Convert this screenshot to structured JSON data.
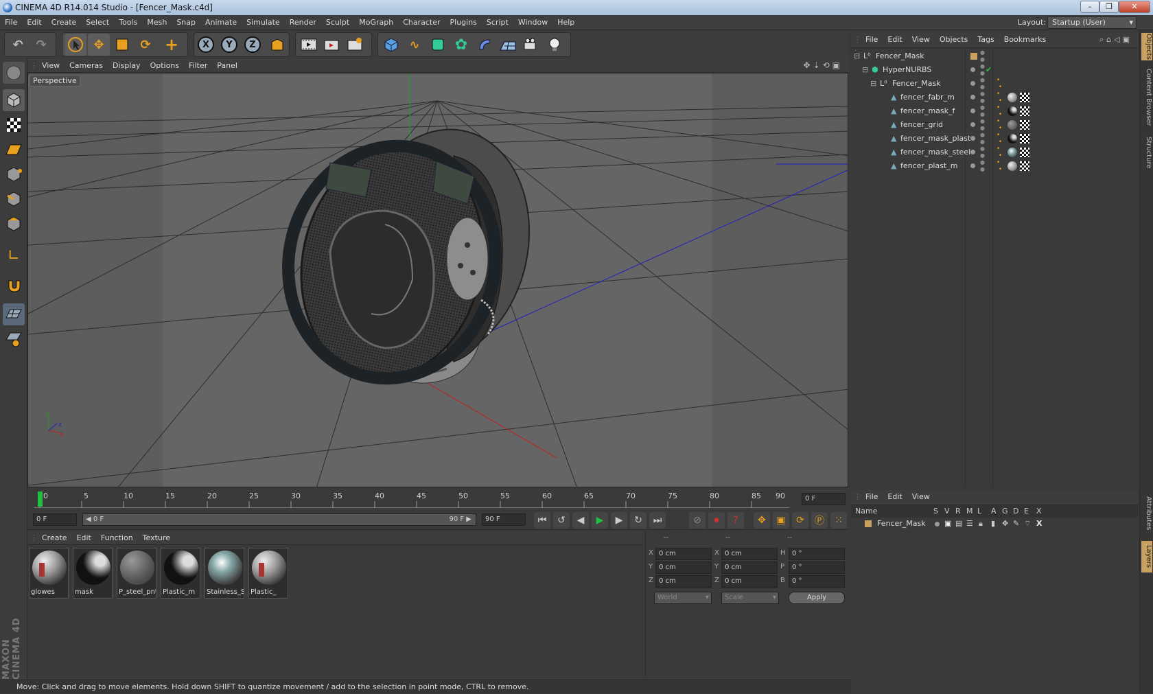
{
  "window": {
    "title": "CINEMA 4D R14.014 Studio - [Fencer_Mask.c4d]",
    "buttons": [
      "–",
      "❐",
      "✕"
    ]
  },
  "menubar": {
    "items": [
      "File",
      "Edit",
      "Create",
      "Select",
      "Tools",
      "Mesh",
      "Snap",
      "Animate",
      "Simulate",
      "Render",
      "Sculpt",
      "MoGraph",
      "Character",
      "Plugins",
      "Script",
      "Window",
      "Help"
    ],
    "layout_label": "Layout:",
    "layout_value": "Startup (User)"
  },
  "toolbar": {
    "axis_x": "X",
    "axis_y": "Y",
    "axis_z": "Z",
    "icons": [
      "undo-icon",
      "redo-icon",
      "live-select-icon",
      "move-icon",
      "scale-icon",
      "rotate-icon",
      "add-icon",
      "x-axis-icon",
      "y-axis-icon",
      "z-axis-icon",
      "world-coord-icon",
      "render-view-icon",
      "render-picture-viewer-icon",
      "edit-render-settings-icon",
      "cube-icon",
      "spline-icon",
      "nurbs-icon",
      "array-icon",
      "deformer-icon",
      "floor-icon",
      "camera-icon",
      "light-icon"
    ]
  },
  "viewport": {
    "menus": [
      "View",
      "Cameras",
      "Display",
      "Options",
      "Filter",
      "Panel"
    ],
    "label": "Perspective",
    "axis_y": "y",
    "axis_z": "z",
    "axis_x": "x"
  },
  "timeline": {
    "ticks": [
      "0",
      "5",
      "10",
      "15",
      "20",
      "25",
      "30",
      "35",
      "40",
      "45",
      "50",
      "55",
      "60",
      "65",
      "70",
      "75",
      "80",
      "85",
      "90"
    ],
    "end_field": "0 F"
  },
  "transport": {
    "start_field": "0 F",
    "range_start": "◀ 0 F",
    "range_end": "90 F ▶",
    "end_field": "90 F"
  },
  "materials": {
    "menus": [
      "Create",
      "Edit",
      "Function",
      "Texture"
    ],
    "items": [
      {
        "name": "glowes",
        "color": "#aa3333"
      },
      {
        "name": "mask",
        "color": "#222222"
      },
      {
        "name": "P_steel_pnt",
        "color": "#777777"
      },
      {
        "name": "Plastic_m",
        "color": "#222222"
      },
      {
        "name": "Stainless_S",
        "color": "#cccccc"
      },
      {
        "name": "Plastic_",
        "color": "#aa3333"
      }
    ]
  },
  "coordinates": {
    "header": [
      "--",
      "--",
      "--"
    ],
    "rows": [
      {
        "a": "X",
        "a_val": "0 cm",
        "b": "X",
        "b_val": "0 cm",
        "c": "H",
        "c_val": "0 °"
      },
      {
        "a": "Y",
        "a_val": "0 cm",
        "b": "Y",
        "b_val": "0 cm",
        "c": "P",
        "c_val": "0 °"
      },
      {
        "a": "Z",
        "a_val": "0 cm",
        "b": "Z",
        "b_val": "0 cm",
        "c": "B",
        "c_val": "0 °"
      }
    ],
    "mode1": "World",
    "mode2": "Scale",
    "apply": "Apply"
  },
  "object_manager": {
    "menus": [
      "File",
      "Edit",
      "View",
      "Objects",
      "Tags",
      "Bookmarks"
    ],
    "objects": [
      {
        "name": "Fencer_Mask",
        "depth": 0
      },
      {
        "name": "HyperNURBS",
        "depth": 1
      },
      {
        "name": "Fencer_Mask",
        "depth": 2
      },
      {
        "name": "fencer_fabr_m",
        "depth": 3
      },
      {
        "name": "fencer_mask_f",
        "depth": 3
      },
      {
        "name": "fencer_grid",
        "depth": 3
      },
      {
        "name": "fencer_mask_plast",
        "depth": 3
      },
      {
        "name": "fencer_mask_steel",
        "depth": 3
      },
      {
        "name": "fencer_plast_m",
        "depth": 3
      }
    ]
  },
  "layer_manager": {
    "menus": [
      "File",
      "Edit",
      "View"
    ],
    "columns": [
      "Name",
      "S",
      "V",
      "R",
      "M",
      "L",
      "A",
      "G",
      "D",
      "E",
      "X"
    ],
    "row_name": "Fencer_Mask"
  },
  "right_tabs": [
    "Objects",
    "Content Browser",
    "Structure",
    "Attributes",
    "Layers"
  ],
  "status": "Move: Click and drag to move elements. Hold down SHIFT to quantize movement / add to the selection in point mode, CTRL to remove.",
  "colors": {
    "accent": "#e8a020",
    "axis_y": "#20a020",
    "axis_x": "#c02020",
    "axis_z": "#2020c0"
  }
}
